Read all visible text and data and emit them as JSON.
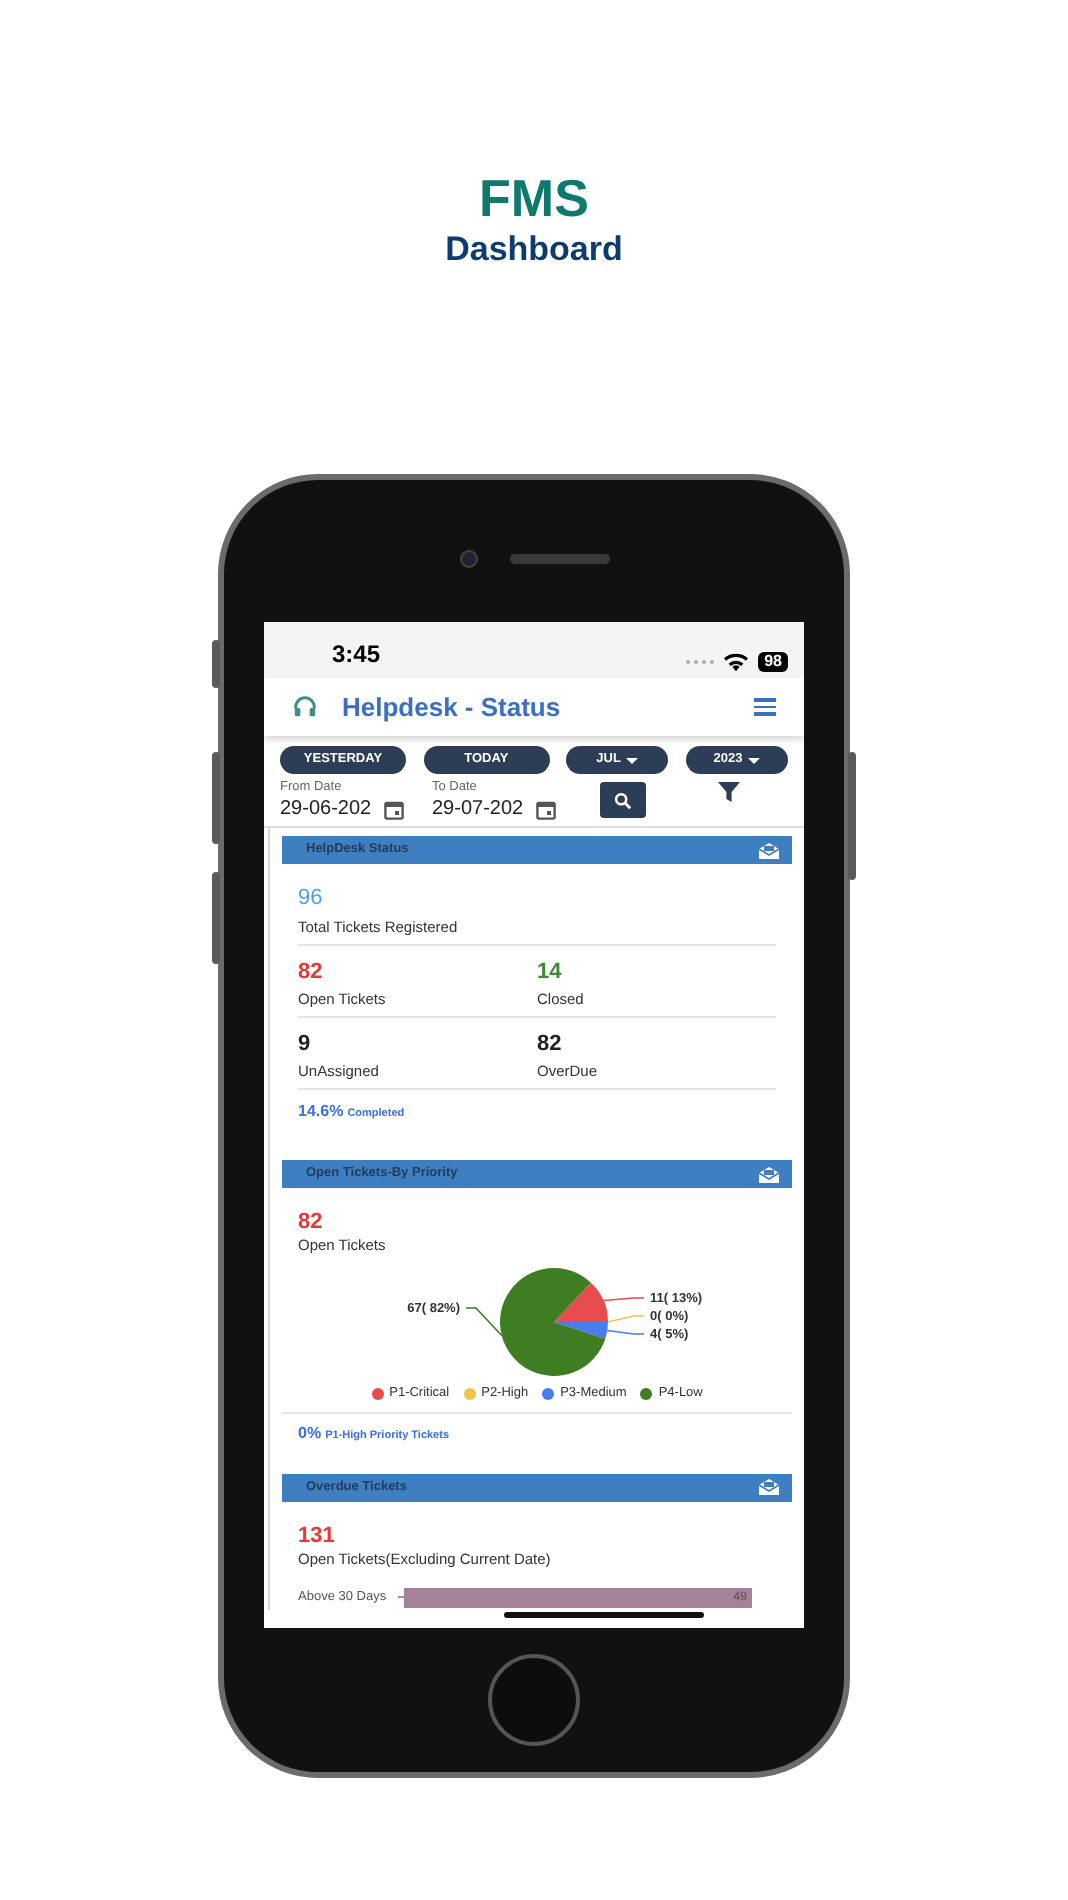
{
  "header": {
    "brand": "FMS",
    "subtitle": "Dashboard"
  },
  "status_bar": {
    "time": "3:45",
    "battery": "98"
  },
  "app_bar": {
    "title": "Helpdesk - Status"
  },
  "filters": {
    "quick": [
      {
        "label": "YESTERDAY",
        "kind": "button"
      },
      {
        "label": "TODAY",
        "kind": "button"
      },
      {
        "label": "JUL",
        "kind": "dropdown"
      },
      {
        "label": "2023",
        "kind": "dropdown"
      }
    ],
    "from": {
      "label": "From Date",
      "value": "29-06-202"
    },
    "to": {
      "label": "To Date",
      "value": "29-07-202"
    }
  },
  "sections": [
    {
      "kind": "stats",
      "title": "HelpDesk Status",
      "total": {
        "value": "96",
        "label": "Total Tickets Registered"
      },
      "stats": [
        {
          "value": "82",
          "label": "Open Tickets",
          "color": "#e53935"
        },
        {
          "value": "14",
          "label": "Closed",
          "color": "#3c8d2f"
        },
        {
          "value": "9",
          "label": "UnAssigned",
          "color": "#222222"
        },
        {
          "value": "82",
          "label": "OverDue",
          "color": "#222222"
        }
      ],
      "footer": {
        "value": "14.6%",
        "label": "Completed"
      }
    },
    {
      "kind": "pie",
      "title": "Open Tickets-By Priority",
      "count": {
        "value": "82",
        "label": "Open Tickets"
      },
      "chart_data": {
        "type": "pie",
        "categories": [
          "P1-Critical",
          "P2-High",
          "P3-Medium",
          "P4-Low"
        ],
        "colors": [
          "#e84c4c",
          "#f2c14e",
          "#4a7bf0",
          "#3f7d22"
        ],
        "series": [
          {
            "values": [
              13,
              0,
              5,
              82
            ]
          }
        ],
        "value_labels": [
          "11( 13%)",
          "0( 0%)",
          "4( 5%)",
          "67( 82%)"
        ]
      },
      "footer": {
        "value": "0%",
        "label": "P1-High Priority Tickets"
      }
    },
    {
      "kind": "bars",
      "title": "Overdue Tickets",
      "count": {
        "value": "131",
        "label": "Open Tickets(Excluding Current Date)"
      },
      "chart_data": {
        "type": "bar",
        "orientation": "horizontal",
        "categories": [
          "Above 30 Days"
        ],
        "series": [
          {
            "color": "#a6819a",
            "values": [
              49
            ]
          }
        ],
        "data_labels": true
      }
    }
  ]
}
